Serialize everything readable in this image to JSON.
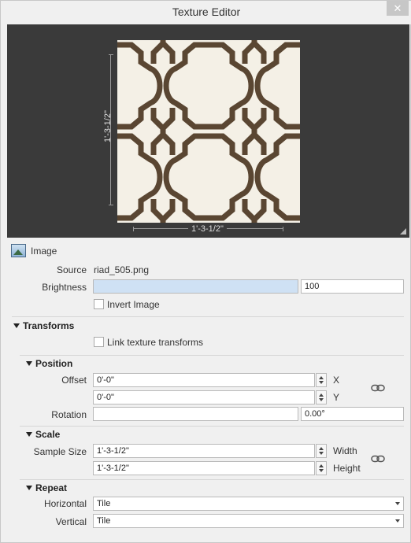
{
  "window": {
    "title": "Texture Editor",
    "close_glyph": "✕"
  },
  "preview": {
    "texture_icon": "moroccan-trellis-pattern",
    "height_dim": "1'-3-1/2\"",
    "width_dim": "1'-3-1/2\""
  },
  "image": {
    "header": "Image",
    "source_label": "Source",
    "source_value": "riad_505.png",
    "brightness_label": "Brightness",
    "brightness_value": "100",
    "invert_label": "Invert Image"
  },
  "transforms": {
    "header": "Transforms",
    "link_label": "Link texture transforms"
  },
  "position": {
    "header": "Position",
    "offset_label": "Offset",
    "offset_x": "0'-0\"",
    "offset_y": "0'-0\"",
    "x_label": "X",
    "y_label": "Y",
    "rotation_label": "Rotation",
    "rotation_value": "",
    "rotation_degrees": "0.00°"
  },
  "scale": {
    "header": "Scale",
    "sample_size_label": "Sample Size",
    "width_value": "1'-3-1/2\"",
    "height_value": "1'-3-1/2\"",
    "width_label": "Width",
    "height_label": "Height"
  },
  "repeat": {
    "header": "Repeat",
    "horizontal_label": "Horizontal",
    "horizontal_value": "Tile",
    "vertical_label": "Vertical",
    "vertical_value": "Tile"
  },
  "colors": {
    "preview_bg": "#3a3a3a",
    "texture_base": "#f4f0e6",
    "texture_pattern": "#5a4632",
    "slider_fill": "#cfe1f4"
  }
}
